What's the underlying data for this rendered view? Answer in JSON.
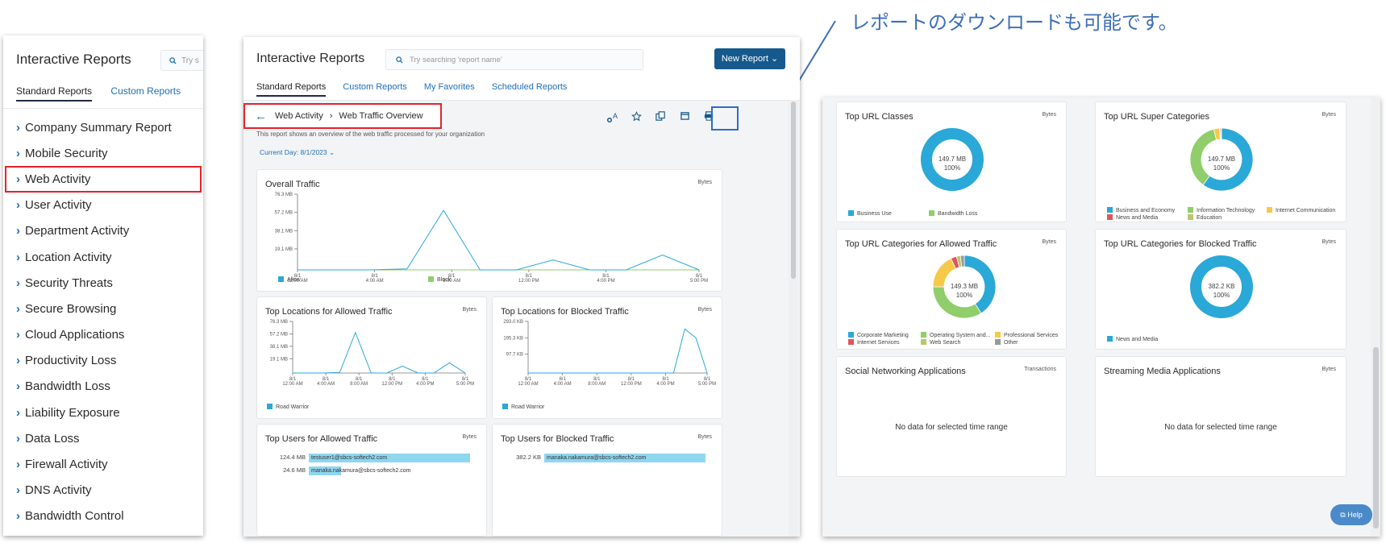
{
  "annotation": {
    "text": "レポートのダウンロードも可能です。"
  },
  "left_panel": {
    "title": "Interactive Reports",
    "search_placeholder": "Try s",
    "tabs": [
      "Standard Reports",
      "Custom Reports"
    ],
    "items": [
      "Company Summary Report",
      "Mobile Security",
      "Web Activity",
      "User Activity",
      "Department Activity",
      "Location Activity",
      "Security Threats",
      "Secure Browsing",
      "Cloud Applications",
      "Productivity Loss",
      "Bandwidth Loss",
      "Liability Exposure",
      "Data Loss",
      "Firewall Activity",
      "DNS Activity",
      "Bandwidth Control"
    ],
    "selected_index": 2
  },
  "middle_panel": {
    "title": "Interactive Reports",
    "search_placeholder": "Try searching 'report name'",
    "new_report_label": "New Report",
    "tabs": [
      "Standard Reports",
      "Custom Reports",
      "My Favorites",
      "Scheduled Reports"
    ],
    "breadcrumb": {
      "parent": "Web Activity",
      "current": "Web Traffic Overview"
    },
    "description": "This report shows an overview of the web traffic processed for your organization",
    "date_filter": "Current Day: 8/1/2023",
    "icons": [
      "text-style-icon",
      "star-icon",
      "copy-icon",
      "calendar-icon",
      "print-icon"
    ],
    "overall": {
      "title": "Overall Traffic",
      "unit": "Bytes",
      "y_ticks": [
        "76.3 MB",
        "57.2 MB",
        "38.1 MB",
        "19.1 MB"
      ],
      "x_ticks": [
        "8/1\n12:00 AM",
        "8/1\n4:00 AM",
        "8/1\n8:00 AM",
        "8/1\n12:00 PM",
        "8/1\n4:00 PM",
        "8/1\n5:00 PM"
      ],
      "legend": [
        "Allow",
        "Block"
      ]
    },
    "loc_allowed": {
      "title": "Top Locations for Allowed Traffic",
      "unit": "Bytes",
      "y_ticks": [
        "76.3 MB",
        "57.2 MB",
        "38.1 MB",
        "19.1 MB"
      ],
      "x_ticks": [
        "8/1\n12:00 AM",
        "8/1\n4:00 AM",
        "8/1\n8:00 AM",
        "8/1\n12:00 PM",
        "8/1\n4:00 PM",
        "8/1\n5:00 PM"
      ],
      "legend": [
        "Road Warrior"
      ]
    },
    "loc_blocked": {
      "title": "Top Locations for Blocked Traffic",
      "unit": "Bytes",
      "y_ticks": [
        "293.0 KB",
        "195.3 KB",
        "97.7 KB"
      ],
      "x_ticks": [
        "8/1\n12:00 AM",
        "8/1\n4:00 AM",
        "8/1\n8:00 AM",
        "8/1\n12:00 PM",
        "8/1\n4:00 PM",
        "8/1\n5:00 PM"
      ],
      "legend": [
        "Road Warrior"
      ]
    },
    "users_allowed": {
      "title": "Top Users for Allowed Traffic",
      "unit": "Bytes",
      "rows": [
        {
          "value": "124.4 MB",
          "user": "testuser1@sbcs-softech2.com",
          "fraction": 1.0
        },
        {
          "value": "24.6 MB",
          "user": "manaka.nakamura@sbcs-softech2.com",
          "fraction": 0.2
        }
      ]
    },
    "users_blocked": {
      "title": "Top Users for Blocked Traffic",
      "unit": "Bytes",
      "rows": [
        {
          "value": "382.2 KB",
          "user": "manaka.nakamura@sbcs-softech2.com",
          "fraction": 1.0
        }
      ]
    }
  },
  "right_panel": {
    "help_label": "Help",
    "url_classes": {
      "title": "Top URL Classes",
      "unit": "Bytes",
      "center": [
        "149.7 MB",
        "100%"
      ],
      "legend": [
        "Business Use",
        "Bandwidth Loss"
      ]
    },
    "url_super": {
      "title": "Top URL Super Categories",
      "unit": "Bytes",
      "center": [
        "149.7 MB",
        "100%"
      ],
      "legend": [
        "Business and Economy",
        "Information Technology",
        "Internet Communication",
        "News and Media",
        "Education"
      ]
    },
    "url_allowed": {
      "title": "Top URL Categories for Allowed Traffic",
      "unit": "Bytes",
      "center": [
        "149.3 MB",
        "100%"
      ],
      "legend": [
        "Corporate Marketing",
        "Operating System and...",
        "Professional Services",
        "Internet Services",
        "Web Search",
        "Other"
      ]
    },
    "url_blocked": {
      "title": "Top URL Categories for Blocked Traffic",
      "unit": "Bytes",
      "center": [
        "382.2 KB",
        "100%"
      ],
      "legend": [
        "News and Media"
      ]
    },
    "social": {
      "title": "Social Networking Applications",
      "unit": "Transactions",
      "empty": "No data for selected time range"
    },
    "streaming": {
      "title": "Streaming Media Applications",
      "unit": "Bytes",
      "empty": "No data for selected time range"
    }
  },
  "colors": {
    "blue": "#2aa8d8",
    "green": "#8fce6a",
    "yellow": "#f7c948",
    "red": "#e0555d",
    "olive": "#b7c96a",
    "gray": "#9a9a9a",
    "accent": "#16598d",
    "highlight": "#e5222a",
    "annot": "#3d6fb7"
  },
  "chart_data": [
    {
      "type": "line",
      "title": "Overall Traffic",
      "ylabel": "Bytes",
      "x": [
        "12:00 AM",
        "2:00 AM",
        "4:00 AM",
        "5:00 AM",
        "6:00 AM",
        "8:00 AM",
        "9:00 AM",
        "10:00 AM",
        "12:00 PM",
        "2:00 PM",
        "4:00 PM",
        "5:00 PM"
      ],
      "series": [
        {
          "name": "Allow",
          "values": [
            0,
            0,
            0,
            1,
            60,
            0,
            0,
            10,
            0,
            0,
            15,
            0
          ]
        },
        {
          "name": "Block",
          "values": [
            0,
            0,
            0,
            0,
            0,
            0,
            0,
            0,
            0,
            0,
            0,
            0
          ]
        }
      ],
      "y_unit": "MB",
      "ylim": [
        0,
        76.3
      ]
    },
    {
      "type": "line",
      "title": "Top Locations for Allowed Traffic",
      "series": [
        {
          "name": "Road Warrior",
          "values": [
            0,
            0,
            0,
            1,
            60,
            0,
            0,
            10,
            0,
            0,
            15,
            0
          ]
        }
      ],
      "y_unit": "MB",
      "ylim": [
        0,
        76.3
      ]
    },
    {
      "type": "line",
      "title": "Top Locations for Blocked Traffic",
      "series": [
        {
          "name": "Road Warrior",
          "values": [
            0,
            0,
            0,
            0,
            0,
            0,
            0,
            0,
            0,
            0,
            0,
            0,
            0,
            0,
            250,
            200,
            0
          ]
        }
      ],
      "y_unit": "KB",
      "ylim": [
        0,
        293.0
      ]
    },
    {
      "type": "pie",
      "title": "Top URL Classes",
      "labels": [
        "Business Use",
        "Bandwidth Loss"
      ],
      "values": [
        100,
        0
      ]
    },
    {
      "type": "pie",
      "title": "Top URL Super Categories",
      "labels": [
        "Business and Economy",
        "Information Technology",
        "Internet Communication",
        "News and Media",
        "Education"
      ],
      "values": [
        60,
        36,
        3,
        0.5,
        0.5
      ]
    },
    {
      "type": "pie",
      "title": "Top URL Categories for Allowed Traffic",
      "labels": [
        "Corporate Marketing",
        "Operating System and...",
        "Professional Services",
        "Internet Services",
        "Web Search",
        "Other"
      ],
      "values": [
        41,
        34,
        18,
        3,
        2,
        2
      ]
    },
    {
      "type": "pie",
      "title": "Top URL Categories for Blocked Traffic",
      "labels": [
        "News and Media"
      ],
      "values": [
        100
      ]
    }
  ]
}
